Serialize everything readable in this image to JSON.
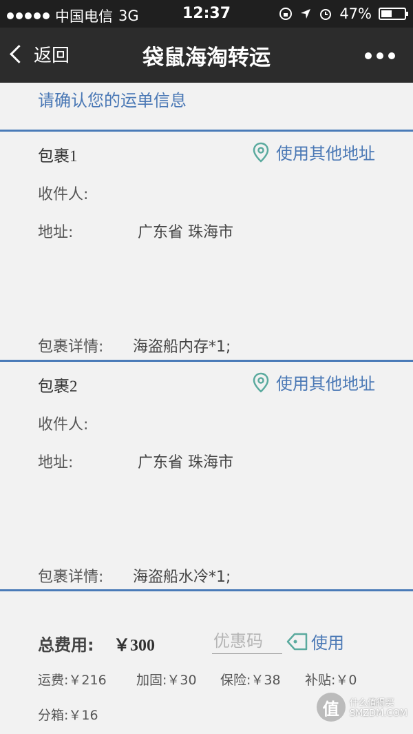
{
  "status": {
    "carrier": "中国电信",
    "network": "3G",
    "time": "12:37",
    "battery": "47%"
  },
  "nav": {
    "back_label": "返回",
    "title": "袋鼠海淘转运"
  },
  "confirm_text": "请确认您的运单信息",
  "packages": [
    {
      "title": "包裹1",
      "alt_address_label": "使用其他地址",
      "recipient_label": "收件人:",
      "address_label": "地址:",
      "address_value": "广东省 珠海市",
      "details_label": "包裹详情:",
      "details_value": "海盗船内存*1;"
    },
    {
      "title": "包裹2",
      "alt_address_label": "使用其他地址",
      "recipient_label": "收件人:",
      "address_label": "地址:",
      "address_value": "广东省 珠海市",
      "details_label": "包裹详情:",
      "details_value": "海盗船水冷*1;"
    }
  ],
  "fees": {
    "total_label": "总费用:",
    "total_value": "￥300",
    "coupon_placeholder": "优惠码",
    "use_label": "使用",
    "items": [
      {
        "text": "运费:￥216"
      },
      {
        "text": "加固:￥30"
      },
      {
        "text": "保险:￥38"
      },
      {
        "text": "补贴:￥0"
      },
      {
        "text": "分箱:￥16"
      }
    ]
  },
  "watermark": {
    "logo_char": "值",
    "line1": "什么值得买",
    "line2": "SMZDM.COM"
  },
  "colors": {
    "accent": "#4a78b5",
    "divider": "#4a7bb8",
    "background": "#f2f2f2",
    "navbar": "#2c2c2c",
    "pin_icon": "#5aaa9e"
  }
}
